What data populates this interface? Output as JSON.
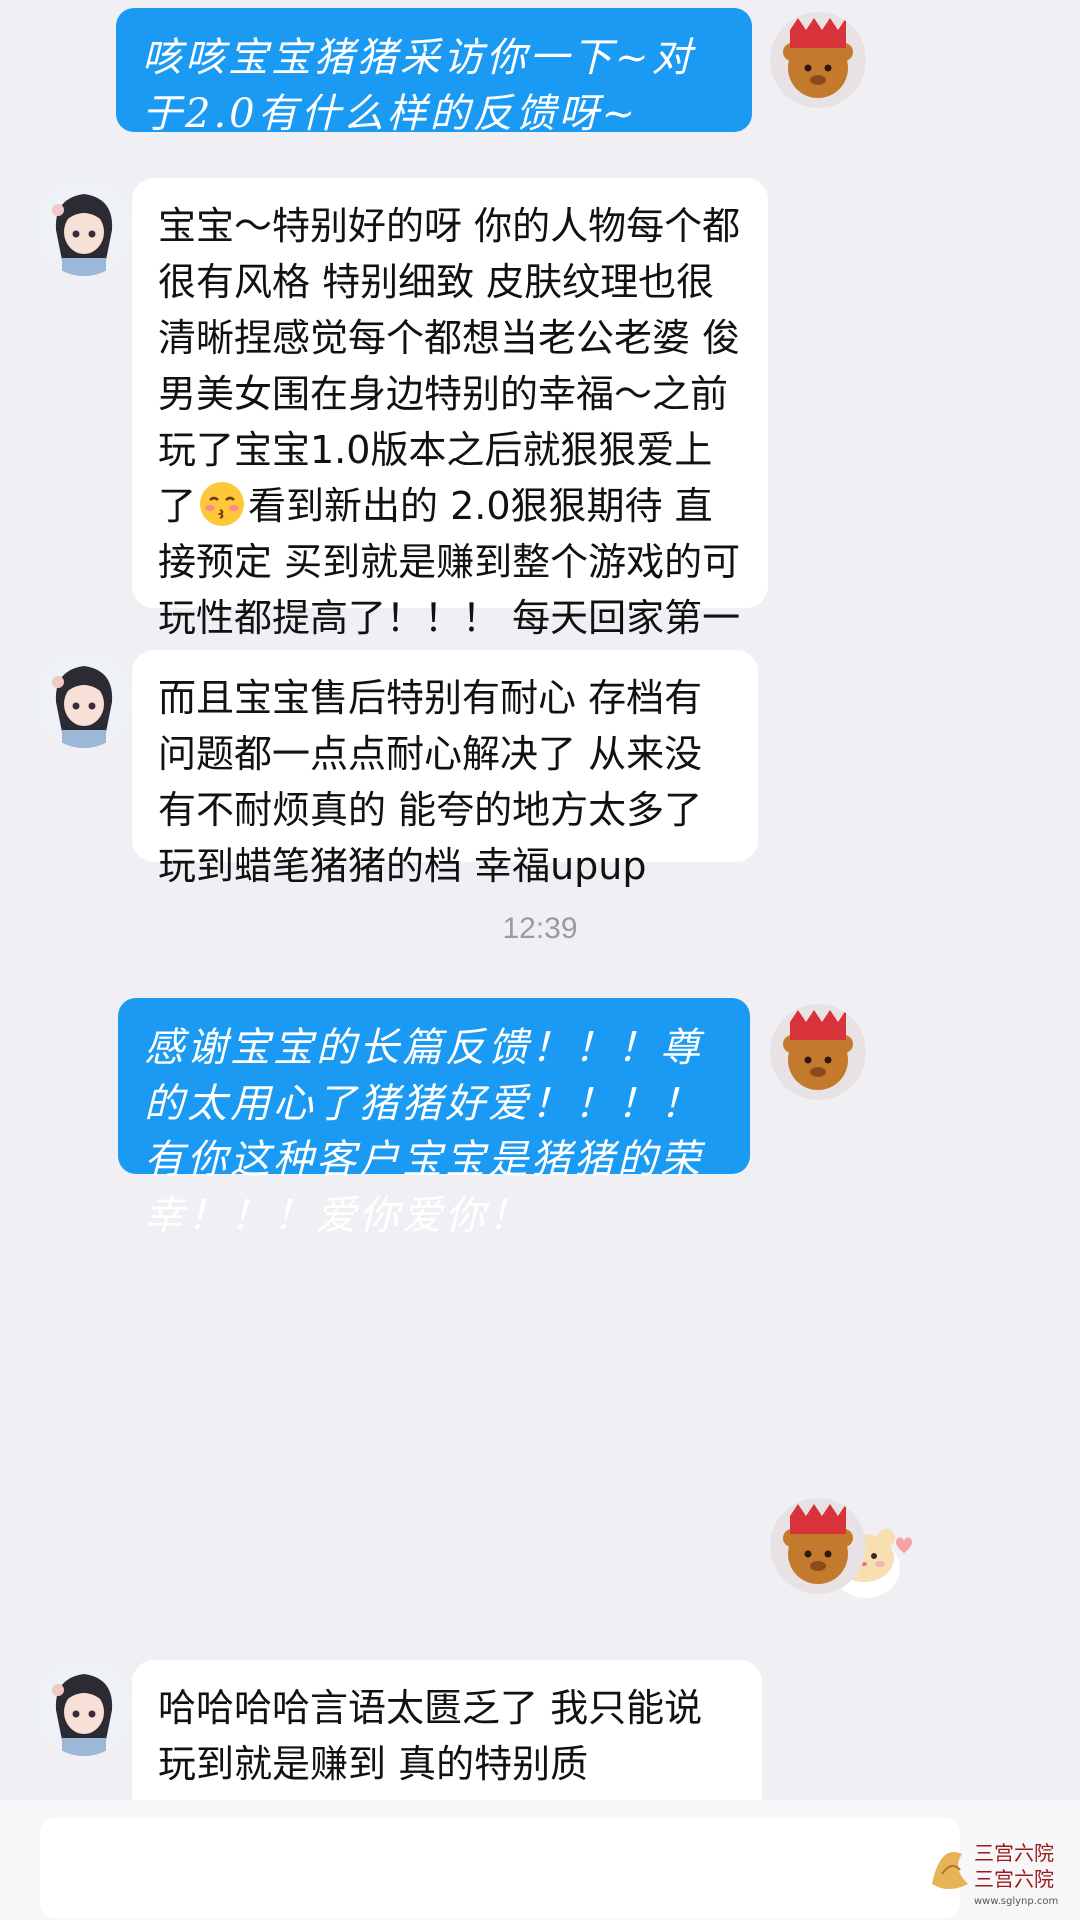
{
  "messages": [
    {
      "id": "m1",
      "side": "out",
      "text": "咳咳宝宝猪猪采访你一下~对于2.0有什么样的反馈呀~"
    },
    {
      "id": "m2",
      "side": "in",
      "text_before_emoji": "宝宝～特别好的呀 你的人物每个都很有风格 特别细致 皮肤纹理也很清晰捏感觉每个都想当老公老婆 俊男美女围在身边特别的幸福～之前玩了宝宝1.0版本之后就狠狠爱上了",
      "emoji": "kissing-face-emoji",
      "text_after_emoji": "看到新出的 2.0狠狠期待 直接预定 买到就是赚到整个游戏的可玩性都提高了！！！ 每天回家第一件事就是打开模开始看我的美腻宝宝们～"
    },
    {
      "id": "m3",
      "side": "in",
      "text": "而且宝宝售后特别有耐心 存档有问题都一点点耐心解决了 从来没有不耐烦真的 能夸的地方太多了 玩到蜡笔猪猪的档 幸福upup"
    },
    {
      "id": "m4",
      "side": "out",
      "text": "感谢宝宝的长篇反馈！！！尊的太用心了猪猪好爱！！！！有你这种客户宝宝是猪猪的荣幸！！！爱你爱你！"
    },
    {
      "id": "m5",
      "side": "out",
      "sticker": "hamster-heart-sticker"
    },
    {
      "id": "m6",
      "side": "in",
      "text": "哈哈哈哈言语太匮乏了 我只能说 玩到就是赚到 真的特别质量！！！！"
    }
  ],
  "timestamp": "12:39",
  "input": {
    "value": "",
    "placeholder": ""
  },
  "watermark": {
    "text": "三宫六院",
    "url": "www.sglynp.com"
  },
  "colors": {
    "background": "#f0f0f4",
    "outgoing_bubble": "#1b9af3",
    "incoming_bubble": "#ffffff",
    "timestamp": "#9a9aa2"
  },
  "icons": {
    "self_avatar": "red-crown-bear-avatar",
    "other_avatar": "anime-girl-avatar"
  }
}
